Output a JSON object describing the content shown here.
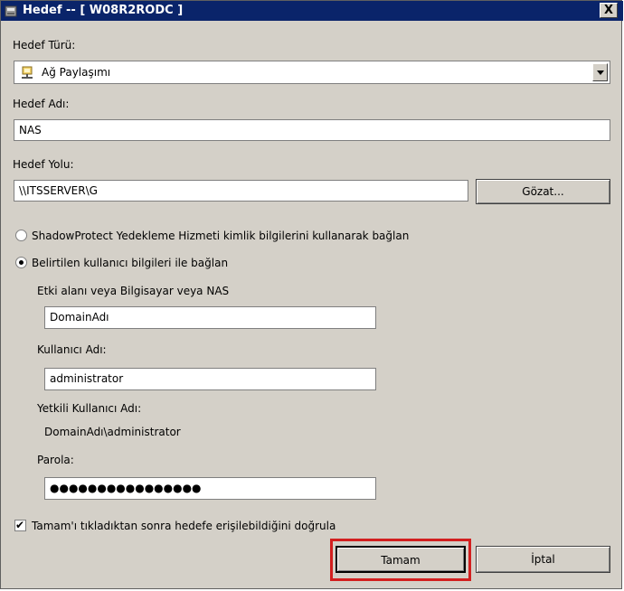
{
  "window": {
    "title": "Hedef -- [ W08R2RODC ]",
    "close_label": "X"
  },
  "target_type": {
    "label": "Hedef Türü:",
    "value": "Ağ Paylaşımı",
    "icon": "network-share-icon"
  },
  "target_name": {
    "label": "Hedef Adı:",
    "value": "NAS"
  },
  "target_path": {
    "label": "Hedef Yolu:",
    "value": "\\\\ITSSERVER\\G",
    "browse_label": "Gözat..."
  },
  "credentials": {
    "option_service": "ShadowProtect Yedekleme Hizmeti kimlik bilgilerini kullanarak bağlan",
    "option_user": "Belirtilen kullanıcı bilgileri ile bağlan",
    "selected": "user"
  },
  "domain": {
    "label": "Etki alanı veya Bilgisayar veya NAS",
    "value": "DomainAdı"
  },
  "username": {
    "label": "Kullanıcı Adı:",
    "value": "administrator"
  },
  "authorized_user": {
    "label": "Yetkili Kullanıcı Adı:",
    "value": "DomainAdı\\administrator"
  },
  "password": {
    "label": "Parola:",
    "value": "●●●●●●●●●●●●●●●●"
  },
  "verify": {
    "label": "Tamam'ı tıkladıktan sonra hedefe erişilebildiğini doğrula",
    "checked": true,
    "check_glyph": "✔"
  },
  "buttons": {
    "ok": "Tamam",
    "cancel": "İptal"
  },
  "colors": {
    "titlebar": "#0a246a",
    "dialog_bg": "#d4d0c8",
    "highlight": "#d21f1f"
  }
}
